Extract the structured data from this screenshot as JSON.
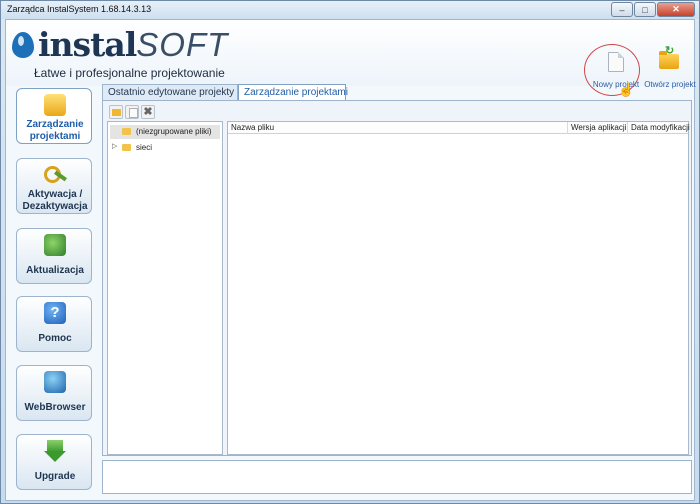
{
  "window": {
    "title": "Zarządca InstalSystem 1.68.14.3.13",
    "controls": {
      "minimize": "–",
      "maximize": "□",
      "close": "✕"
    }
  },
  "header": {
    "brand_main": "instal",
    "brand_accent": "SOFT",
    "slogan": "Łatwe i profesjonalne projektowanie"
  },
  "actions": {
    "new_project": {
      "label": "Nowy projekt",
      "icon": "new-document-icon"
    },
    "open_project": {
      "label": "Otwórz projekt",
      "icon": "open-folder-icon"
    }
  },
  "sidebar": {
    "items": [
      {
        "line1": "Zarządzanie",
        "line2": "projektami",
        "icon": "folder-icon",
        "active": true
      },
      {
        "line1": "Aktywacja /",
        "line2": "Dezaktywacja",
        "icon": "key-icon",
        "active": false
      },
      {
        "line1": "Aktualizacja",
        "line2": "",
        "icon": "update-icon",
        "active": false
      },
      {
        "line1": "Pomoc",
        "line2": "",
        "icon": "help-icon",
        "active": false
      },
      {
        "line1": "WebBrowser",
        "line2": "",
        "icon": "globe-icon",
        "active": false
      },
      {
        "line1": "Upgrade",
        "line2": "",
        "icon": "upgrade-arrow-icon",
        "active": false
      }
    ]
  },
  "tabs": [
    {
      "label": "Ostatnio edytowane projekty",
      "active": false
    },
    {
      "label": "Zarządzanie projektami",
      "active": true
    }
  ],
  "toolbar": {
    "buttons": [
      "new-folder-icon",
      "copy-icon",
      "delete-icon"
    ],
    "delete_glyph": "✖"
  },
  "tree": {
    "items": [
      {
        "label": "(niezgrupowane pliki)",
        "selected": true,
        "expandable": false
      },
      {
        "label": "sieci",
        "selected": false,
        "expandable": true
      }
    ],
    "expand_glyph": "▷"
  },
  "table": {
    "columns": [
      "Nazwa pliku",
      "Wersja aplikacji",
      "Data modyfikacji"
    ],
    "rows": []
  },
  "help_glyph": "?",
  "cursor_glyph": "☝"
}
